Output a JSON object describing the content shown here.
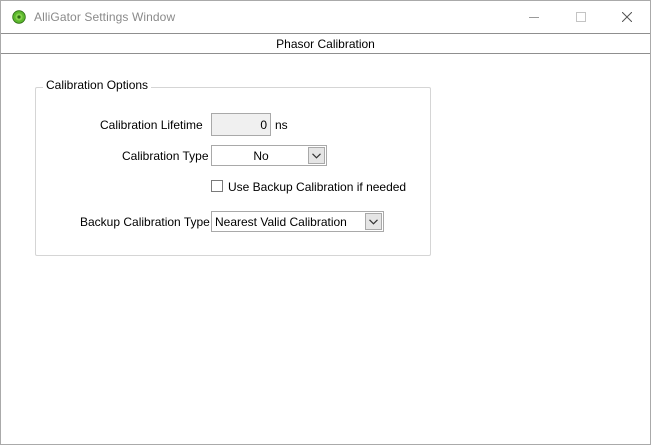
{
  "window": {
    "title": "AlliGator Settings Window",
    "icon": "alligator-app-icon",
    "controls": {
      "minimize": "minimize-icon",
      "maximize": "maximize-icon",
      "close": "close-icon"
    }
  },
  "tab": {
    "label": "Phasor Calibration"
  },
  "calibration_options": {
    "legend": "Calibration Options",
    "lifetime_label": "Calibration Lifetime",
    "lifetime_value": "0",
    "lifetime_unit": "ns",
    "type_label": "Calibration Type",
    "type_value": "No",
    "backup_checkbox_label": "Use Backup Calibration if needed",
    "backup_checkbox_checked": false,
    "backup_type_label": "Backup Calibration Type",
    "backup_type_value": "Nearest Valid Calibration"
  },
  "colors": {
    "title_text": "#8a8a8a",
    "icon_green": "#5cb82e"
  }
}
